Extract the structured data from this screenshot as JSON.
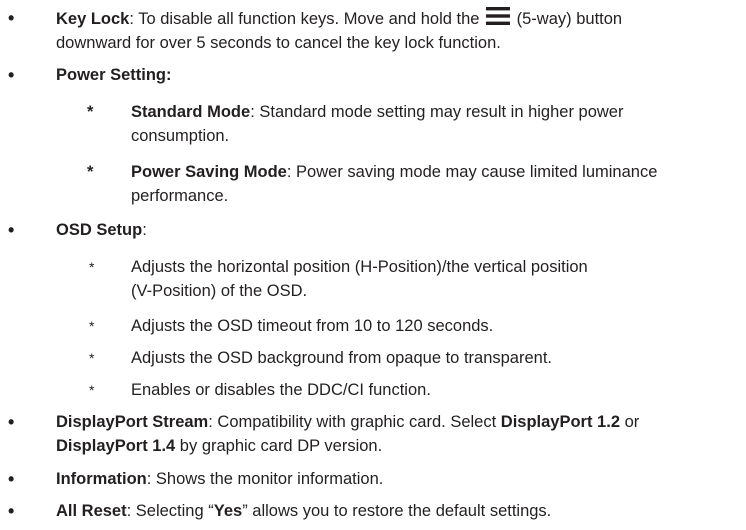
{
  "bullet_symbol": "•",
  "sub_symbol": "*",
  "key_lock": {
    "term": "Key Lock",
    "text_before_icon": ": To disable all function keys. Move and hold the ",
    "icon": "menu-5way-icon",
    "text_after_icon": " (5-way) button",
    "line2": "downward for over 5 seconds to cancel the key lock function."
  },
  "power_setting": {
    "term": "Power Setting:",
    "standard": {
      "term": "Standard Mode",
      "line1": ": Standard mode setting may result in higher power",
      "line2": "consumption."
    },
    "saving": {
      "term": "Power Saving Mode",
      "line1": ": Power saving mode may cause limited luminance",
      "line2": "performance."
    }
  },
  "osd_setup": {
    "term": "OSD Setup",
    "colon": ":",
    "items": [
      {
        "line1": "Adjusts the horizontal position (H-Position)/the vertical position",
        "line2": "(V-Position) of the OSD."
      },
      {
        "line1": "Adjusts the OSD timeout from 10 to 120 seconds.",
        "line2": ""
      },
      {
        "line1": "Adjusts the OSD background from opaque to transparent.",
        "line2": ""
      },
      {
        "line1": "Enables or disables the DDC/CI function.",
        "line2": ""
      }
    ]
  },
  "displayport": {
    "term": "DisplayPort Stream",
    "text1": ": Compatibility with graphic card. Select ",
    "opt1": "DisplayPort 1.2",
    "or": " or",
    "opt2": "DisplayPort 1.4",
    "text2": " by graphic card DP version."
  },
  "information": {
    "term": "Information",
    "text": ": Shows the monitor information."
  },
  "all_reset": {
    "term": "All Reset",
    "text1": ": Selecting “",
    "yes": "Yes",
    "text2": "” allows you to restore the default settings."
  }
}
